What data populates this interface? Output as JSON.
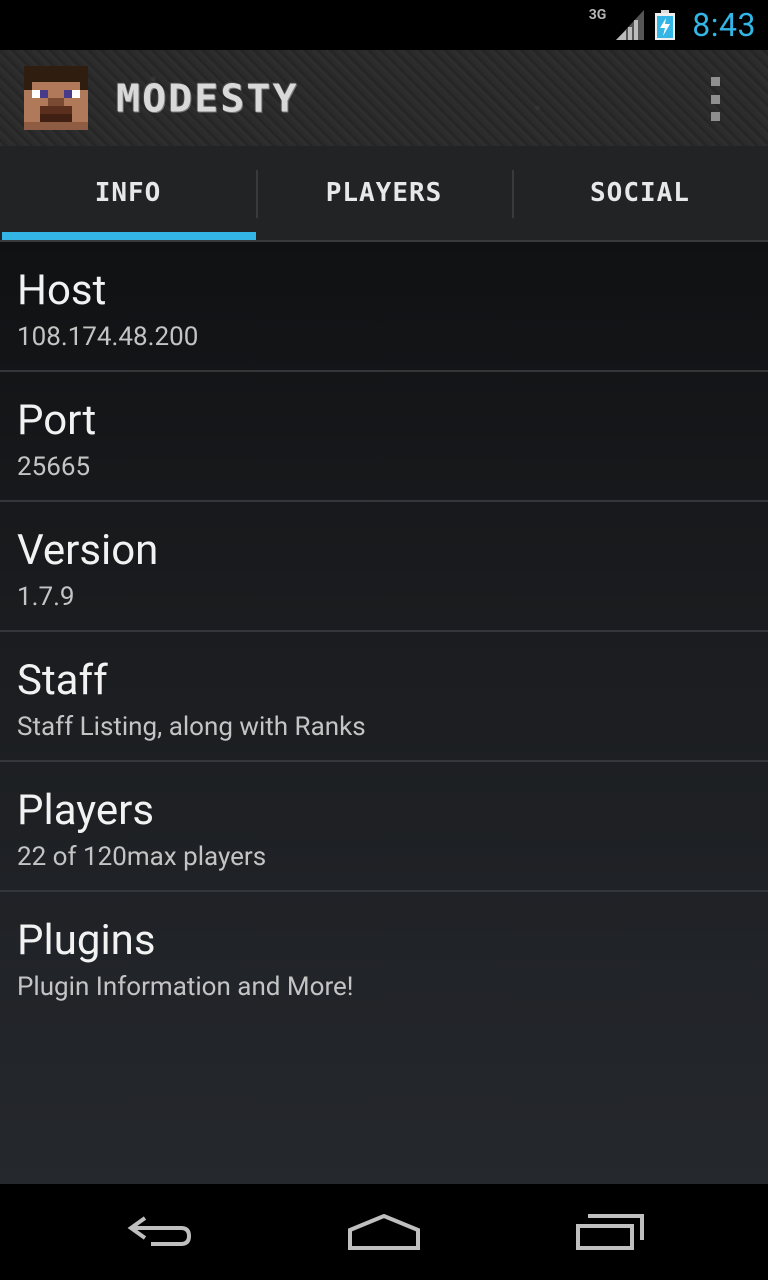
{
  "status_bar": {
    "network_type": "3G",
    "time": "8:43",
    "icons": [
      "signal-icon",
      "battery-charging-icon"
    ]
  },
  "action_bar": {
    "title": "MODESTY",
    "avatar_icon": "minecraft-face-icon",
    "overflow_icon": "overflow-menu-icon"
  },
  "tabs": [
    {
      "label": "INFO",
      "selected": true
    },
    {
      "label": "PLAYERS",
      "selected": false
    },
    {
      "label": "SOCIAL",
      "selected": false
    }
  ],
  "items": [
    {
      "title": "Host",
      "subtitle": "108.174.48.200"
    },
    {
      "title": "Port",
      "subtitle": "25665"
    },
    {
      "title": "Version",
      "subtitle": "1.7.9"
    },
    {
      "title": "Staff",
      "subtitle": "Staff Listing, along with Ranks"
    },
    {
      "title": "Players",
      "subtitle": "22 of 120max players"
    },
    {
      "title": "Plugins",
      "subtitle": "Plugin Information and More!"
    }
  ],
  "nav_bar": {
    "icons": [
      "back-icon",
      "home-icon",
      "recents-icon"
    ]
  },
  "colors": {
    "accent": "#33b5e5",
    "status_time": "#33b5e5"
  }
}
